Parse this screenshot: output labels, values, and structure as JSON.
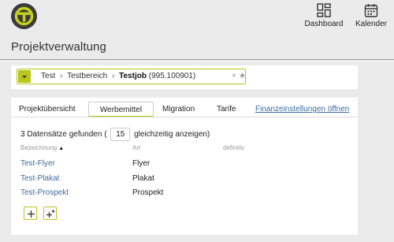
{
  "header": {
    "logo_icon": "t-logo-icon",
    "nav": [
      {
        "label": "Dashboard",
        "icon": "dashboard-grid-icon"
      },
      {
        "label": "Kalender",
        "icon": "calendar-icon"
      }
    ]
  },
  "page": {
    "title": "Projektverwaltung"
  },
  "selector": {
    "breadcrumb": [
      "Test",
      "Testbereich"
    ],
    "separator": "›",
    "job": "Testjob",
    "job_id": "(995.100901)",
    "clear": "×",
    "favorite": "★"
  },
  "tabs": [
    {
      "label": "Projektübersicht",
      "active": false
    },
    {
      "label": "Werbemittel",
      "active": true
    },
    {
      "label": "Migration",
      "active": false
    },
    {
      "label": "Tarife",
      "active": false
    },
    {
      "label": "Finanzeinstellungen öffnen",
      "active": false,
      "link": true
    }
  ],
  "list": {
    "count_prefix": "3 Datensätze gefunden (",
    "page_size": "15",
    "count_suffix": "gleichzeitig anzeigen)",
    "columns": {
      "bezeichnung": "Bezeichnung",
      "sort": "▲",
      "art": "Art",
      "definitiv": "definitiv"
    },
    "rows": [
      {
        "bezeichnung": "Test-Flyer",
        "art": "Flyer"
      },
      {
        "bezeichnung": "Test-Plakat",
        "art": "Plakat"
      },
      {
        "bezeichnung": "Test-Prospekt",
        "art": "Prospekt"
      }
    ]
  },
  "actions": [
    {
      "name": "add-icon"
    },
    {
      "name": "add-multiple-icon"
    }
  ],
  "colors": {
    "accent": "#b9c61a",
    "link": "#3e6c9e",
    "logo_bg": "#3c3c3c"
  }
}
